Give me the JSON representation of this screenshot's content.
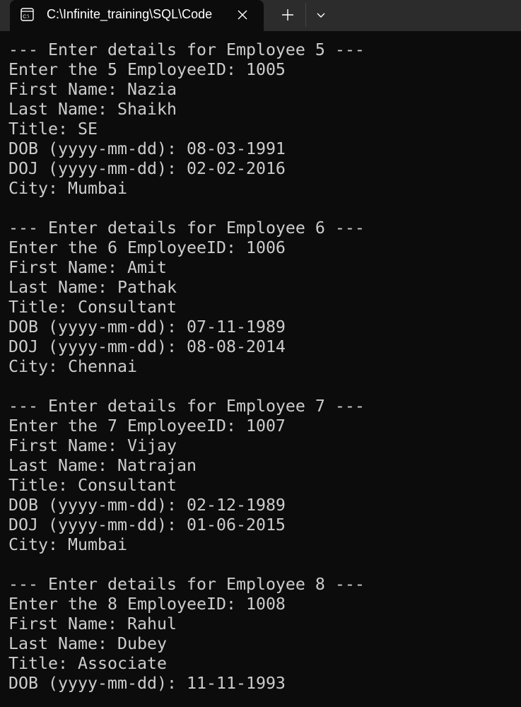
{
  "tab": {
    "title": "C:\\Infinite_training\\SQL\\Code",
    "icon": "cmd-icon"
  },
  "terminal": {
    "lines": [
      "--- Enter details for Employee 5 ---",
      "Enter the 5 EmployeeID: 1005",
      "First Name: Nazia",
      "Last Name: Shaikh",
      "Title: SE",
      "DOB (yyyy-mm-dd): 08-03-1991",
      "DOJ (yyyy-mm-dd): 02-02-2016",
      "City: Mumbai",
      "",
      "--- Enter details for Employee 6 ---",
      "Enter the 6 EmployeeID: 1006",
      "First Name: Amit",
      "Last Name: Pathak",
      "Title: Consultant",
      "DOB (yyyy-mm-dd): 07-11-1989",
      "DOJ (yyyy-mm-dd): 08-08-2014",
      "City: Chennai",
      "",
      "--- Enter details for Employee 7 ---",
      "Enter the 7 EmployeeID: 1007",
      "First Name: Vijay",
      "Last Name: Natrajan",
      "Title: Consultant",
      "DOB (yyyy-mm-dd): 02-12-1989",
      "DOJ (yyyy-mm-dd): 01-06-2015",
      "City: Mumbai",
      "",
      "--- Enter details for Employee 8 ---",
      "Enter the 8 EmployeeID: 1008",
      "First Name: Rahul",
      "Last Name: Dubey",
      "Title: Associate",
      "DOB (yyyy-mm-dd): 11-11-1993"
    ]
  },
  "colors": {
    "background": "#0c0c0c",
    "text": "#cccccc",
    "tabbar": "#2c2c2c"
  }
}
